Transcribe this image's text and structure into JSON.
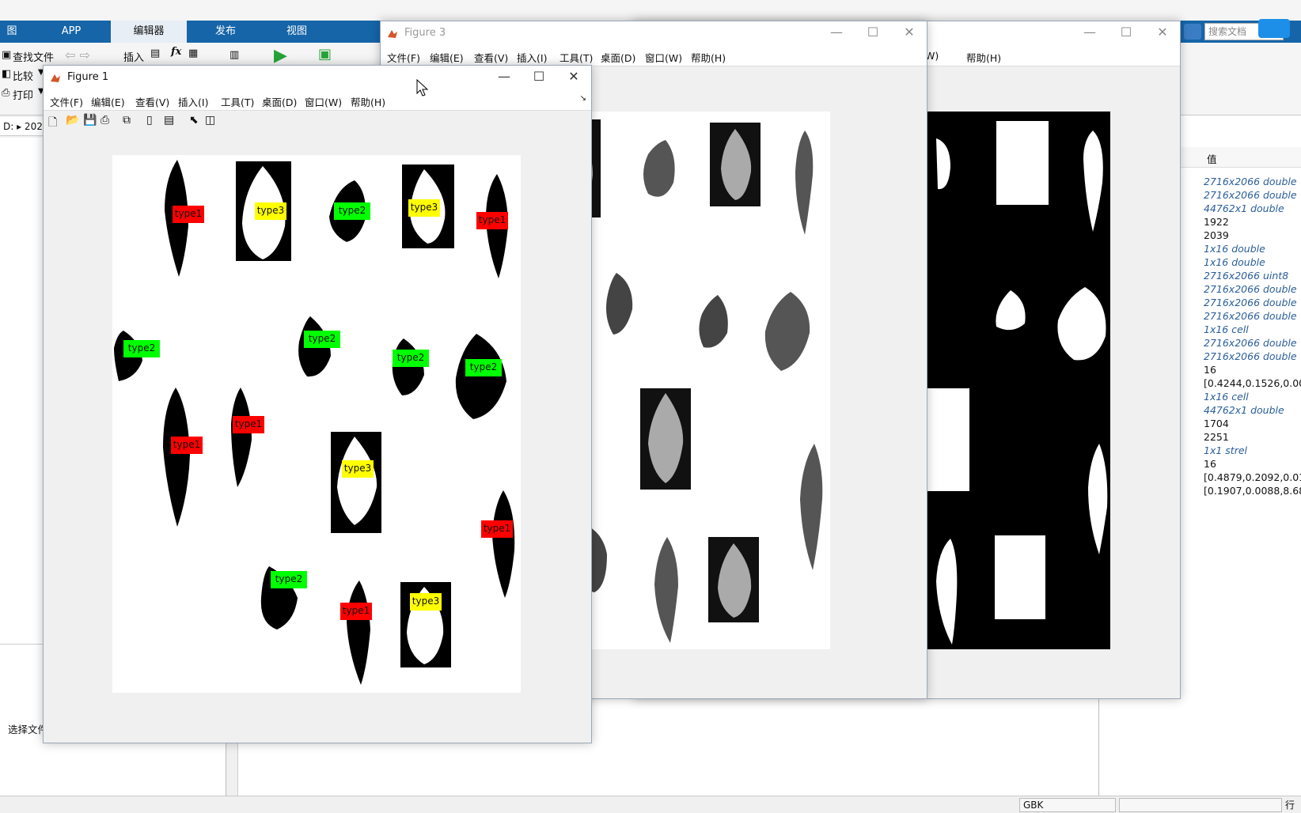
{
  "desktop": {
    "tabs": [
      {
        "label": "图"
      },
      {
        "label": "APP"
      },
      {
        "label": "编辑器"
      },
      {
        "label": "发布"
      },
      {
        "label": "视图"
      }
    ],
    "search_placeholder": "搜索文档",
    "ribbon": {
      "find_files": "查找文件",
      "compare": "比较",
      "print": "打印",
      "insert": "插入",
      "fx": "fx"
    },
    "address": "D: ▸ 202",
    "left_panel_text": "选择文件",
    "status": {
      "encoding": "GBK",
      "right": "行"
    },
    "workspace": {
      "header": "值",
      "values": [
        {
          "text": "2716x2066 double",
          "italic": true
        },
        {
          "text": "2716x2066 double",
          "italic": true
        },
        {
          "text": "44762x1 double",
          "italic": true
        },
        {
          "text": "1922",
          "italic": false
        },
        {
          "text": "2039",
          "italic": false
        },
        {
          "text": "1x16 double",
          "italic": true
        },
        {
          "text": "1x16 double",
          "italic": true
        },
        {
          "text": "2716x2066 uint8",
          "italic": true
        },
        {
          "text": "2716x2066 double",
          "italic": true
        },
        {
          "text": "2716x2066 double",
          "italic": true
        },
        {
          "text": "2716x2066 double",
          "italic": true
        },
        {
          "text": "1x16 cell",
          "italic": true
        },
        {
          "text": "2716x2066 double",
          "italic": true
        },
        {
          "text": "2716x2066 double",
          "italic": true
        },
        {
          "text": "16",
          "italic": false
        },
        {
          "text": "[0.4244,0.1526,0.00...",
          "italic": false
        },
        {
          "text": "1x16 cell",
          "italic": true
        },
        {
          "text": "44762x1 double",
          "italic": true
        },
        {
          "text": "1704",
          "italic": false
        },
        {
          "text": "2251",
          "italic": false
        },
        {
          "text": "1x1 strel",
          "italic": true
        },
        {
          "text": "16",
          "italic": false
        },
        {
          "text": "[0.4879,0.2092,0.01...",
          "italic": false
        },
        {
          "text": "[0.1907,0.0088,8.68...",
          "italic": false
        }
      ]
    }
  },
  "figure1": {
    "title": "Figure 1",
    "menus": [
      "文件(F)",
      "编辑(E)",
      "查看(V)",
      "插入(I)",
      "工具(T)",
      "桌面(D)",
      "窗口(W)",
      "帮助(H)"
    ],
    "labels": [
      {
        "text": "type1",
        "color": "#ff0000"
      },
      {
        "text": "type3",
        "color": "#ffff00"
      },
      {
        "text": "type2",
        "color": "#00ff00"
      },
      {
        "text": "type3",
        "color": "#ffff00"
      },
      {
        "text": "type1",
        "color": "#ff0000"
      },
      {
        "text": "type2",
        "color": "#00ff00"
      },
      {
        "text": "type2",
        "color": "#00ff00"
      },
      {
        "text": "type2",
        "color": "#00ff00"
      },
      {
        "text": "type2",
        "color": "#00ff00"
      },
      {
        "text": "type1",
        "color": "#ff0000"
      },
      {
        "text": "type1",
        "color": "#ff0000"
      },
      {
        "text": "type3",
        "color": "#ffff00"
      },
      {
        "text": "type1",
        "color": "#ff0000"
      },
      {
        "text": "type2",
        "color": "#00ff00"
      },
      {
        "text": "type1",
        "color": "#ff0000"
      },
      {
        "text": "type3",
        "color": "#ffff00"
      }
    ]
  },
  "figure3": {
    "title": "Figure 3",
    "menus": [
      "文件(F)",
      "编辑(E)",
      "查看(V)",
      "插入(I)",
      "工具(T)",
      "桌面(D)",
      "窗口(W)",
      "帮助(H)"
    ]
  },
  "figure2": {
    "menus": [
      "W)",
      "帮助(H)"
    ]
  }
}
